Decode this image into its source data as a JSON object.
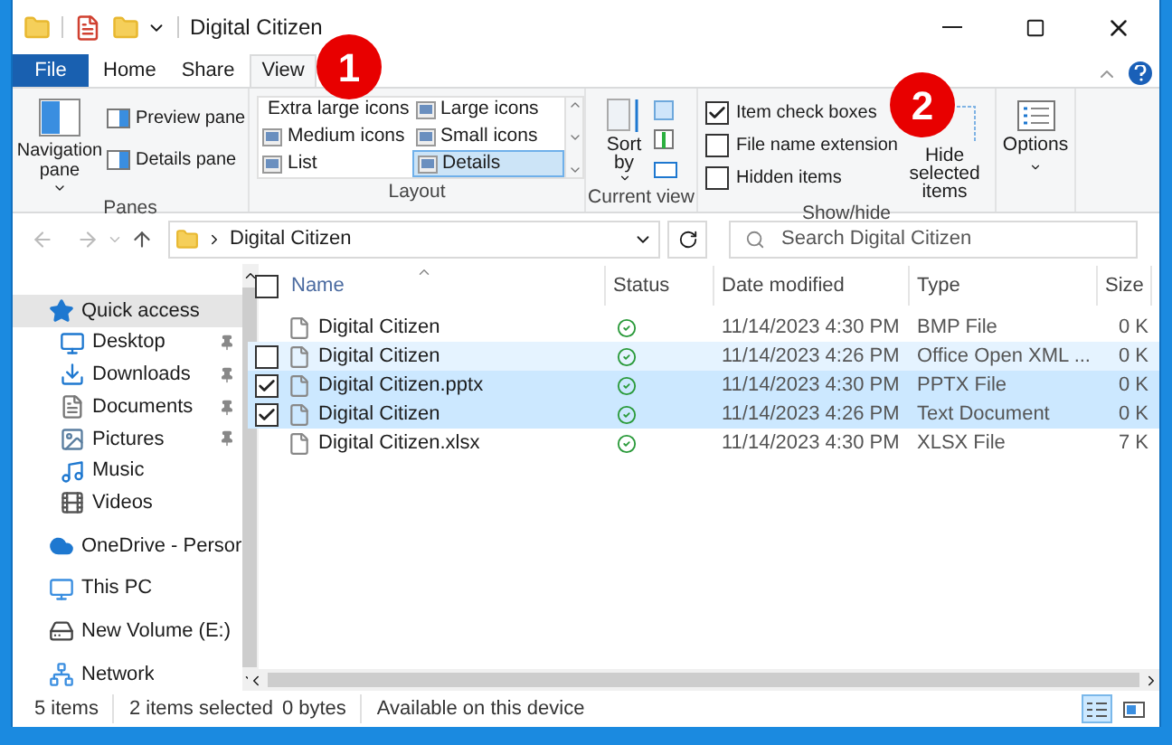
{
  "window": {
    "title": "Digital Citizen"
  },
  "ribbon_tabs": [
    {
      "label": "File",
      "kind": "file",
      "selected": false
    },
    {
      "label": "Home",
      "kind": "tab",
      "selected": false
    },
    {
      "label": "Share",
      "kind": "tab",
      "selected": false
    },
    {
      "label": "View",
      "kind": "tab",
      "selected": true
    }
  ],
  "callouts": [
    "1",
    "2"
  ],
  "panes": {
    "navigation_pane": "Navigation pane",
    "preview_pane": "Preview pane",
    "details_pane": "Details pane",
    "label": "Panes"
  },
  "layout": {
    "label": "Layout",
    "items": [
      {
        "label": "Extra large icons",
        "selected": false
      },
      {
        "label": "Large icons",
        "selected": false
      },
      {
        "label": "Medium icons",
        "selected": false
      },
      {
        "label": "Small icons",
        "selected": false
      },
      {
        "label": "List",
        "selected": false
      },
      {
        "label": "Details",
        "selected": true
      }
    ]
  },
  "current_view": {
    "sort_by": "Sort by",
    "label": "Current view"
  },
  "show_hide": {
    "label": "Show/hide",
    "hide_selected": "Hide selected items",
    "options": [
      {
        "label": "Item check boxes",
        "checked": true
      },
      {
        "label": "File name extension",
        "checked": false
      },
      {
        "label": "Hidden items",
        "checked": false
      }
    ]
  },
  "options": {
    "label": "Options"
  },
  "address": {
    "path": "Digital Citizen"
  },
  "search": {
    "placeholder": "Search Digital Citizen"
  },
  "navigation": [
    {
      "label": "Quick access",
      "selected": true,
      "children": [
        {
          "label": "Desktop",
          "pinned": true
        },
        {
          "label": "Downloads",
          "pinned": true
        },
        {
          "label": "Documents",
          "pinned": true
        },
        {
          "label": "Pictures",
          "pinned": true
        },
        {
          "label": "Music",
          "pinned": false
        },
        {
          "label": "Videos",
          "pinned": false
        }
      ]
    },
    {
      "label": "OneDrive - Persor",
      "selected": false
    },
    {
      "label": "This PC",
      "selected": false
    },
    {
      "label": "New Volume (E:)",
      "selected": false
    },
    {
      "label": "Network",
      "selected": false
    }
  ],
  "file_list": {
    "select_all": {
      "checked": false
    },
    "columns": [
      "Name",
      "Status",
      "Date modified",
      "Type",
      "Size"
    ],
    "rows": [
      {
        "name": "Digital Citizen",
        "date": "11/14/2023 4:30 PM",
        "type": "BMP File",
        "size": "0 K",
        "selected": false,
        "hovered": false
      },
      {
        "name": "Digital Citizen",
        "date": "11/14/2023 4:26 PM",
        "type": "Office Open XML ...",
        "size": "0 K",
        "selected": false,
        "hovered": true
      },
      {
        "name": "Digital Citizen.pptx",
        "date": "11/14/2023 4:30 PM",
        "type": "PPTX File",
        "size": "0 K",
        "selected": true,
        "hovered": false
      },
      {
        "name": "Digital Citizen",
        "date": "11/14/2023 4:26 PM",
        "type": "Text Document",
        "size": "0 K",
        "selected": true,
        "hovered": false
      },
      {
        "name": "Digital Citizen.xlsx",
        "date": "11/14/2023 4:30 PM",
        "type": "XLSX File",
        "size": "7 K",
        "selected": false,
        "hovered": false
      }
    ]
  },
  "status_bar": {
    "items": "5 items",
    "selected": "2 items selected",
    "size": "0 bytes",
    "availability": "Available on this device"
  }
}
